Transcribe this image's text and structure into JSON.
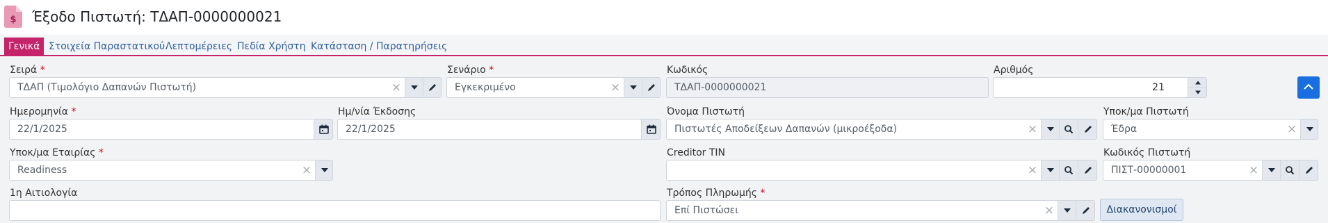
{
  "header": {
    "title": "Έξοδο Πιστωτή: ΤΔΑΠ-0000000021",
    "icon": "document-dollar-icon",
    "icon_color": "#c5246a"
  },
  "tabs": [
    {
      "label": "Γενικά",
      "active": true
    },
    {
      "label": "Στοιχεία Παραστατικού",
      "active": false
    },
    {
      "label": "Λεπτομέρειες",
      "active": false
    },
    {
      "label": "Πεδία Χρήστη",
      "active": false
    },
    {
      "label": "Κατάσταση / Παρατηρήσεις",
      "active": false
    }
  ],
  "fields": {
    "series": {
      "label": "Σειρά",
      "required": "*",
      "value": "ΤΔΑΠ (Τιμολόγιο Δαπανών Πιστωτή)"
    },
    "scenario": {
      "label": "Σενάριο",
      "required": "*",
      "value": "Εγκεκριμένο"
    },
    "code": {
      "label": "Κωδικός",
      "value": "ΤΔΑΠ-0000000021"
    },
    "number": {
      "label": "Αριθμός",
      "value": "21"
    },
    "date": {
      "label": "Ημερομηνία",
      "required": "*",
      "value": "22/1/2025"
    },
    "issue_date": {
      "label": "Ημ/νία Έκδοσης",
      "value": "22/1/2025"
    },
    "creditor_name": {
      "label": "Όνομα Πιστωτή",
      "value": "Πιστωτές Αποδείξεων Δαπανών (μικροέξοδα)"
    },
    "creditor_branch": {
      "label": "Υποκ/μα Πιστωτή",
      "value": "Έδρα"
    },
    "company_branch": {
      "label": "Υποκ/μα Εταιρίας",
      "required": "*",
      "value": "Readiness"
    },
    "creditor_tin": {
      "label": "Creditor TIN",
      "value": ""
    },
    "creditor_code": {
      "label": "Κωδικός Πιστωτή",
      "value": "ΠΙΣΤ-00000001"
    },
    "reason": {
      "label": "1η Αιτιολογία",
      "value": ""
    },
    "payment_method": {
      "label": "Τρόπος Πληρωμής",
      "required": "*",
      "value": "Επί Πιστώσει"
    }
  },
  "buttons": {
    "settlements": "Διακανονισμοί"
  },
  "colors": {
    "accent": "#c5246a",
    "link": "#2f5f9e",
    "primary": "#1a6fe0"
  }
}
